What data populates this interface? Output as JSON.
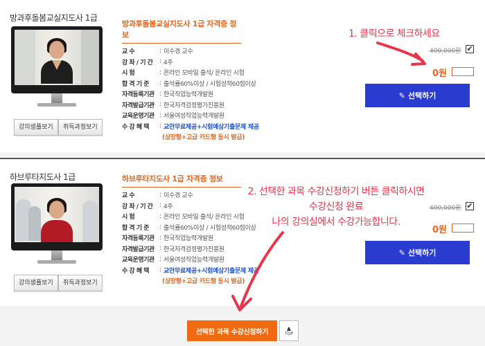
{
  "labels": {
    "instructor": "교 수",
    "lecture": "강 좌 / 기 간",
    "exam": "시 험",
    "pass": "합 격 기 준",
    "reg_org": "자격등록기관",
    "issue_org": "자격발급기관",
    "edu_org": "교육운영기관",
    "benefit": "수 강 혜 택"
  },
  "courses": [
    {
      "name": "방과후돌봄교실지도사 1급",
      "title": "방과후돌봄교실지도사 1급 자격증 정보",
      "instructor": "이수경 교수",
      "period": "4주",
      "exam": "온라인 모바일 출석/ 온라인 시험",
      "pass": "출석률60%이상 / 시험성적60점이상",
      "reg_org": "한국직업능력개발원",
      "issue_org": "한국자격검정평가진흥원",
      "edu_org": "서울여성직업능력개발원",
      "benefit": "교안무료제공+시험예상기출문제 제공",
      "benefit2": "(상장형+고급 카드형 동시 발급)",
      "sample_btn": "강의샘플보기",
      "procedure_btn": "취득과정보기",
      "old_price": "400,000원",
      "checked": "✔",
      "price": "0원",
      "select_btn": "선택하기"
    },
    {
      "name": "하브루타지도사 1급",
      "title": "하브루타지도사 1급 자격증 정보",
      "instructor": "이수경 교수",
      "period": "4주",
      "exam": "온라인 모바일 출석/ 온라인 시험",
      "pass": "출석률60%이상 / 시험성적60점이상",
      "reg_org": "한국직업능력개발원",
      "issue_org": "한국자격검정평가진흥원",
      "edu_org": "서울여성직업능력개발원",
      "benefit": "교안무료제공+시험예상기출문제 제공",
      "benefit2": "(상장형+고급 카드형 동시 발급)",
      "sample_btn": "강의샘플보기",
      "procedure_btn": "취득과정보기",
      "old_price": "400,000원",
      "checked": "✔",
      "price": "0원",
      "select_btn": "선택하기"
    }
  ],
  "annotations": {
    "step1": "1. 클릭으로 체크하세요",
    "step2_line1": "2. 선택한 과목 수강신청하기 버튼 클릭하시면",
    "step2_line2": "수강신청 완료",
    "step2_line3": "나의 강의실에서 수강가능합니다."
  },
  "footer": {
    "enroll_btn": "선택한 과목 수강신청하기",
    "top_btn": "TOP"
  },
  "colors": {
    "accent_orange": "#e8641e",
    "select_blue": "#2a3ccf",
    "annotation_red": "#e8354a"
  },
  "icons": {
    "select": "pencil-icon",
    "top": "up-triangle-icon"
  }
}
